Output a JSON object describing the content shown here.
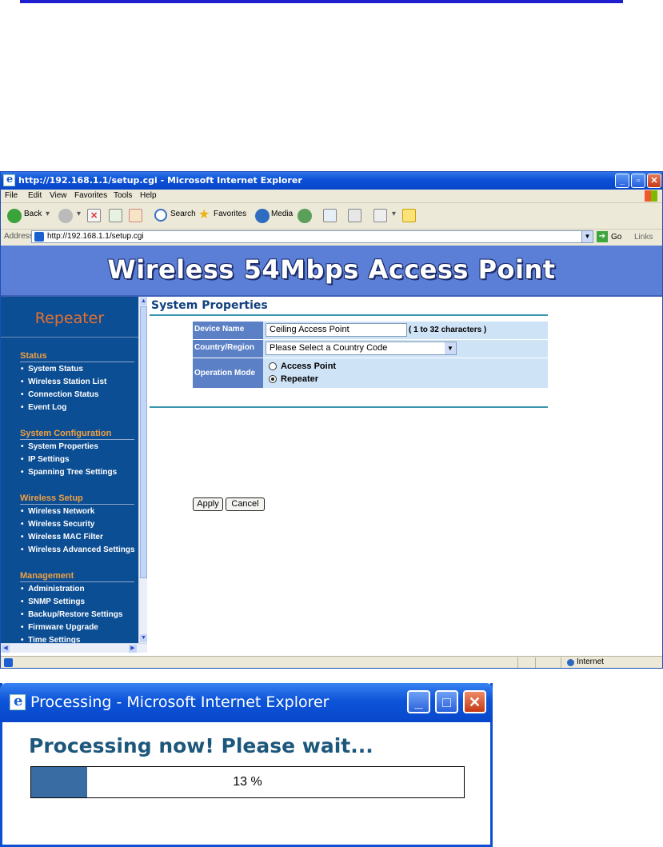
{
  "ie": {
    "title": "http://192.168.1.1/setup.cgi - Microsoft Internet Explorer",
    "menu": [
      "File",
      "Edit",
      "View",
      "Favorites",
      "Tools",
      "Help"
    ],
    "toolbar": {
      "back": "Back",
      "search": "Search",
      "favorites": "Favorites",
      "media": "Media"
    },
    "address_label": "Address",
    "address_url": "http://192.168.1.1/setup.cgi",
    "go_label": "Go",
    "links_label": "Links",
    "status_zone": "Internet"
  },
  "page": {
    "banner_title": "Wireless 54Mbps Access Point",
    "mode_heading": "Repeater",
    "sections": [
      {
        "title": "Status",
        "items": [
          "System Status",
          "Wireless Station List",
          "Connection Status",
          "Event Log"
        ]
      },
      {
        "title": "System Configuration",
        "items": [
          "System Properties",
          "IP Settings",
          "Spanning Tree Settings"
        ]
      },
      {
        "title": "Wireless Setup",
        "items": [
          "Wireless Network",
          "Wireless Security",
          "Wireless MAC Filter",
          "Wireless Advanced Settings"
        ]
      },
      {
        "title": "Management",
        "items": [
          "Administration",
          "SNMP Settings",
          "Backup/Restore Settings",
          "Firmware Upgrade",
          "Time Settings"
        ]
      }
    ],
    "content_title": "System Properties",
    "form": {
      "device_name_label": "Device Name",
      "device_name_value": "Ceiling Access Point",
      "device_name_hint": "( 1 to 32 characters )",
      "country_label": "Country/Region",
      "country_value": "Please Select a Country Code",
      "mode_label": "Operation Mode",
      "mode_options": [
        "Access Point",
        "Repeater"
      ],
      "mode_selected": "Repeater"
    },
    "apply_label": "Apply",
    "cancel_label": "Cancel"
  },
  "popup": {
    "title": "Processing - Microsoft Internet Explorer",
    "message": "Processing now! Please wait...",
    "progress_percent": 13,
    "progress_label": "13 %"
  }
}
